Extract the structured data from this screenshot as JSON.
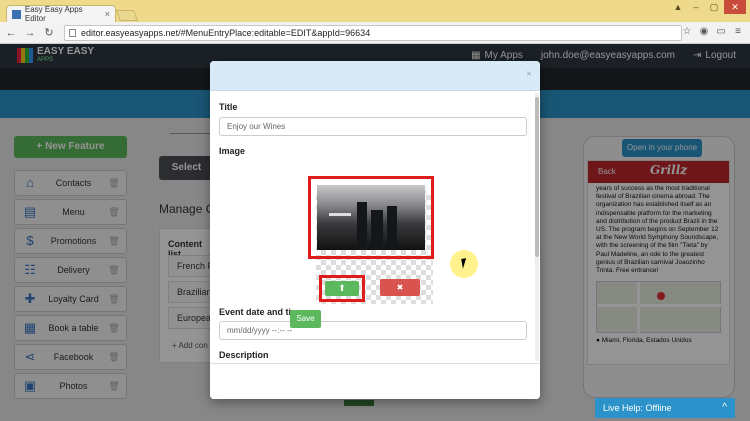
{
  "browser": {
    "tab_title": "Easy Easy Apps Editor",
    "tab_close": "×",
    "url": "editor.easyeasyapps.net/#MenuEntryPlace:editable=EDIT&appId=96634"
  },
  "header": {
    "logo_line1": "EASY EASY",
    "logo_line2": "APPS",
    "my_apps": "My Apps",
    "user_email": "john.doe@easyeasyapps.com",
    "logout": "Logout"
  },
  "sidebar": {
    "new_feature": "+ New Feature",
    "items": [
      {
        "label": "Contacts",
        "icon": "home-icon",
        "glyph": "⌂"
      },
      {
        "label": "Menu",
        "icon": "book-icon",
        "glyph": "▤"
      },
      {
        "label": "Promotions",
        "icon": "dollar-icon",
        "glyph": "$"
      },
      {
        "label": "Delivery",
        "icon": "clipboard-icon",
        "glyph": "☷"
      },
      {
        "label": "Loyalty Card",
        "icon": "gift-icon",
        "glyph": "✚"
      },
      {
        "label": "Book a table",
        "icon": "calendar-icon",
        "glyph": "▦"
      },
      {
        "label": "Facebook",
        "icon": "share-icon",
        "glyph": "⋖"
      },
      {
        "label": "Photos",
        "icon": "photo-icon",
        "glyph": "▣"
      }
    ]
  },
  "main": {
    "select_label": "Select",
    "manage_heading": "Manage C",
    "content_title": "Content list",
    "rows": [
      "French Fr",
      "Brazilian",
      "European"
    ],
    "add_content": "+ Add con"
  },
  "phone": {
    "open_button": "Open in your phone",
    "back": "Back",
    "brand": "Grillz",
    "text": "years of success as the most traditional festival of Brazilian cinema abroad. The organization has established itself as an indispensable platform for the marketing and distribution of the product Brazil in the US. The program begins on September 12 at the New World Symphony Soundscape, with the screening of the film \"Tieta\" by Paul Madeline, an ode to the greatest genius of Brazilian carnival Joaozinho Trinta. Free entrance!",
    "location": "Miami, Florida, Estados Unidos"
  },
  "modal": {
    "close": "×",
    "title_label": "Title",
    "title_value": "Enjoy our Wines",
    "image_label": "Image",
    "upload_glyph": "⬆",
    "remove_glyph": "✖",
    "event_label": "Event date and time",
    "event_placeholder": "mm/dd/yyyy --:-- --",
    "description_label": "Description",
    "save_label": "Save"
  },
  "live_help": {
    "label": "Live Help: Offline",
    "arrow": "^"
  },
  "colors": {
    "header": "#2d3843",
    "accent_blue": "#2b93c9",
    "success": "#5cb85c",
    "danger": "#d9534f",
    "highlight": "#e01b1b"
  }
}
